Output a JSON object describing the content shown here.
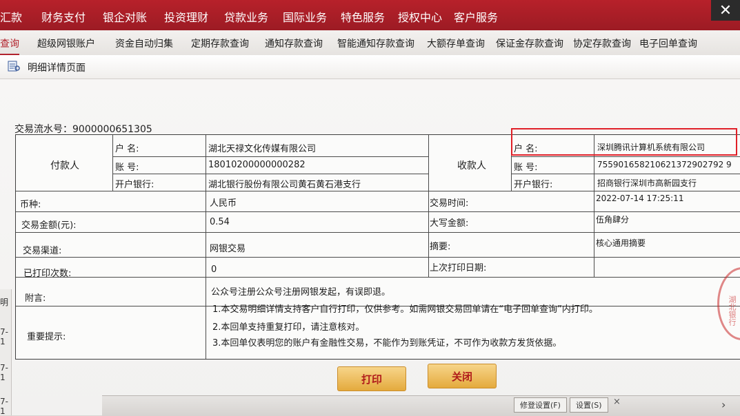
{
  "top_menu": [
    "汇款",
    "财务支付",
    "银企对账",
    "投资理财",
    "贷款业务",
    "国际业务",
    "特色服务",
    "授权中心",
    "客户服务"
  ],
  "sub_tabs": [
    "查询",
    "超级网银账户",
    "资金自动归集",
    "定期存款查询",
    "通知存款查询",
    "智能通知存款查询",
    "大额存单查询",
    "保证金存款查询",
    "协定存款查询",
    "电子回单查询"
  ],
  "page": {
    "title": "明细详情页面"
  },
  "receipt": {
    "serial_label": "交易流水号：",
    "serial_no": "9000000651305",
    "payer": {
      "label": "付款人",
      "name_label": "户 名:",
      "name": "湖北天禄文化传媒有限公司",
      "account_label": "账 号:",
      "account": "18010200000000282",
      "bank_label": "开户银行:",
      "bank": "湖北银行股份有限公司黄石黄石港支行"
    },
    "payee": {
      "label": "收款人",
      "name_label": "户 名:",
      "name": "深圳腾讯计算机系统有限公司",
      "account_label": "账 号:",
      "account": "755901658210621372902792 9",
      "bank_label": "开户银行:",
      "bank": "招商银行深圳市高新园支行"
    },
    "currency_label": "币种:",
    "currency": "人民币",
    "time_label": "交易时间:",
    "time": "2022-07-14 17:25:11",
    "amount_label": "交易金额(元):",
    "amount": "0.54",
    "amount_upper_label": "大写金额:",
    "amount_upper": "伍角肆分",
    "channel_label": "交易渠道:",
    "channel": "网银交易",
    "summary_label": "摘要:",
    "summary": "核心通用摘要",
    "print_count_label": "已打印次数:",
    "print_count": "0",
    "last_print_label": "上次打印日期:",
    "last_print": "",
    "remark_label": "附言:",
    "remark": "公众号注册公众号注册网银发起，有误即退。",
    "notice_label": "重要提示:",
    "notices": [
      "1.本交易明细详情支持客户自行打印，仅供参考。如需网银交易回单请在“电子回单查询”内打印。",
      "2.本回单支持重复打印，请注意核对。",
      "3.本回单仅表明您的账户有金融性交易，不能作为到账凭证，不可作为收款方发货依据。"
    ]
  },
  "buttons": {
    "print": "打印",
    "close": "关闭"
  },
  "bottom_bar": {
    "btn1": "修登设置(F)",
    "btn2": "设置(S)"
  },
  "left_strip": [
    "明",
    "7-1",
    "7-1",
    "7-1"
  ],
  "stamp_text": "湖北银行"
}
